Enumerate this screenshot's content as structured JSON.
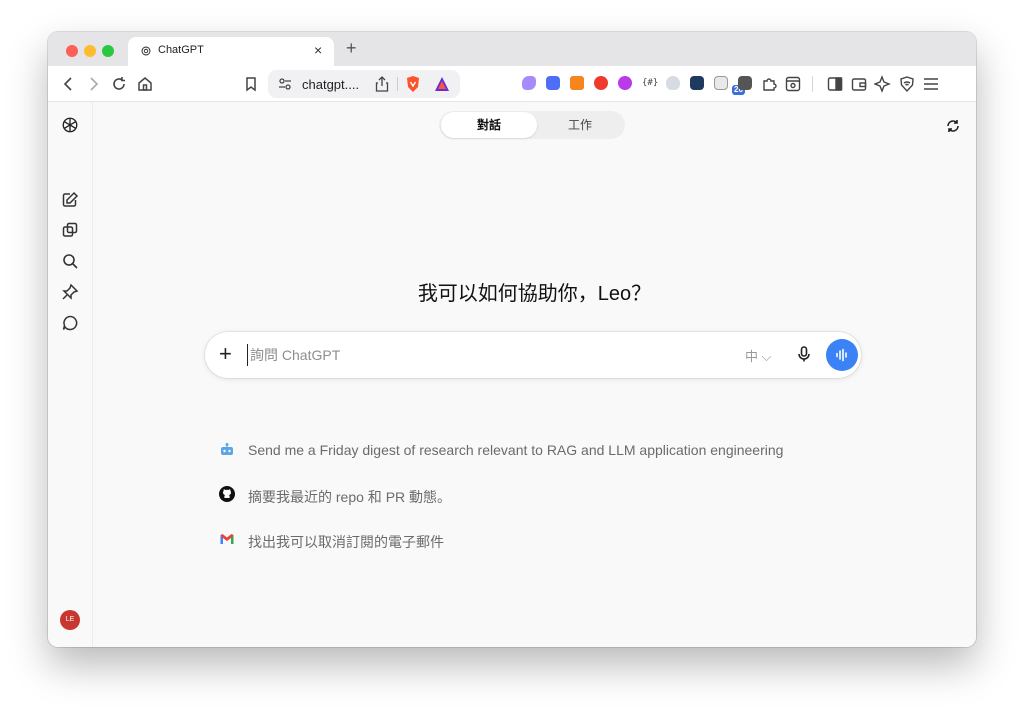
{
  "browser": {
    "tab_title": "ChatGPT",
    "tab_close": "×",
    "new_tab": "+",
    "url": "chatgpt....",
    "extension_badge": "26"
  },
  "sidebar": {
    "items": [
      {
        "icon": "chatgpt-logo-icon"
      },
      {
        "icon": "new-chat-icon"
      },
      {
        "icon": "library-icon"
      },
      {
        "icon": "search-icon"
      },
      {
        "icon": "pin-icon"
      },
      {
        "icon": "chat-bubble-icon"
      }
    ],
    "avatar_initials": "LE"
  },
  "main": {
    "tabs": [
      {
        "label": "對話",
        "active": true
      },
      {
        "label": "工作",
        "active": false
      }
    ],
    "greeting": "我可以如何協助你，Leo？",
    "composer": {
      "plus": "+",
      "placeholder": "詢問 ChatGPT",
      "value": "",
      "language": "中 ⌵"
    },
    "suggestions": [
      {
        "icon": "robot-icon",
        "text": "Send me a Friday digest of research relevant to RAG and LLM application engineering"
      },
      {
        "icon": "github-icon",
        "text": "摘要我最近的 repo 和 PR 動態。"
      },
      {
        "icon": "gmail-icon",
        "text": "找出我可以取消訂閱的電子郵件"
      }
    ]
  },
  "colors": {
    "accent": "#3b82f6",
    "avatar": "#c8372f",
    "background": "#f9f9f9"
  }
}
